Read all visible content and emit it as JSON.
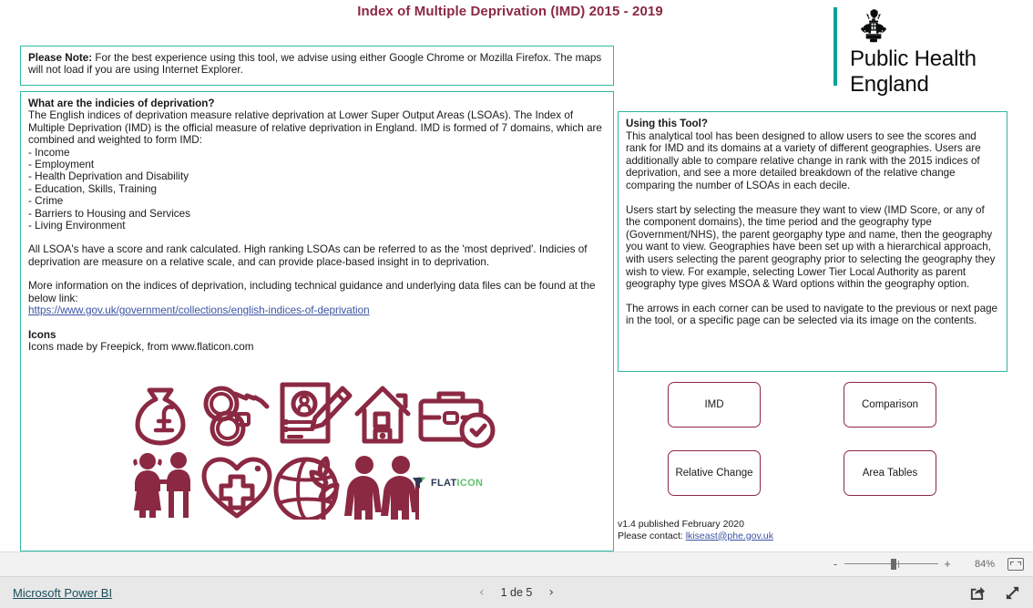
{
  "report": {
    "title": "Index of Multiple Deprivation (IMD) 2015 - 2019"
  },
  "logo": {
    "line1": "Public Health",
    "line2": "England",
    "crest_name": "royal-crest-icon",
    "rule_color": "#00A39B"
  },
  "note": {
    "label": "Please Note:",
    "text": " For the best experience using this tool, we advise using either Google Chrome or Mozilla Firefox. The maps will not load if you are using Internet Explorer."
  },
  "indices": {
    "heading": "What are the indicies of deprivation?",
    "intro": "The English indices of deprivation measure relative deprivation at Lower Super Output Areas (LSOAs). The Index of Multiple Deprivation (IMD) is the official measure of relative deprivation in England. IMD is formed of 7 domains, which are combined and weighted to form IMD:",
    "domains": [
      "- Income",
      "- Employment",
      "- Health Deprivation and Disability",
      "- Education, Skills, Training",
      "- Crime",
      "- Barriers to Housing and Services",
      "- Living Environment"
    ],
    "para2": "All LSOA's have a score and rank calculated. High ranking LSOAs can be referred to as the 'most deprived'. Indicies of deprivation are measure on a relative scale, and can provide place-based insight in to deprivation.",
    "para3": "More information on the indices of deprivation, including technical guidance and underlying data files can be found at the below link:",
    "link": "https://www.gov.uk/government/collections/english-indices-of-deprivation",
    "icons_heading": "Icons",
    "icons_credit": "Icons made by Freepick, from www.flaticon.com",
    "icon_art": {
      "color": "#8B2942",
      "items": [
        "money-bag-pound-icon",
        "handcuffs-icon",
        "document-person-pencil-icon",
        "house-icon",
        "briefcase-clock-icon",
        "children-holding-hands-icon",
        "heart-medical-cross-icon",
        "globe-plant-icon",
        "elderly-couple-icon"
      ],
      "watermark": {
        "part1": "FLAT",
        "part2": "ICON"
      }
    }
  },
  "tool": {
    "heading": "Using this Tool?",
    "para1": "This analytical tool has been designed to allow users to see the scores and rank for IMD and its domains at a variety of different geographies. Users are additionally able to compare relative change in rank  with the 2015 indices of deprivation, and see a more detailed breakdown of the relative change comparing the number of LSOAs in each decile.",
    "para2": "Users start by selecting the measure they want to view (IMD Score, or any of the component domains), the time period and the geography type (Government/NHS), the parent georgaphy type and name, then the geography you want to view. Geographies have been set up with a hierarchical approach, with users selecting the parent geography prior to selecting the geography they wish to view. For example, selecting Lower Tier Local Authority as parent geography type gives MSOA & Ward options within the geography option.",
    "para3": "The arrows in each corner can be used to navigate to the previous or next page in the tool, or a specific page can be selected via its image on the contents."
  },
  "nav_buttons": {
    "border_color": "#8B2942",
    "imd": "IMD",
    "comparison": "Comparison",
    "relative_change": "Relative Change",
    "area_tables": "Area Tables"
  },
  "credit": {
    "version": "v1.4 published February 2020",
    "contact_label": "Please contact: ",
    "contact_email": "lkiseast@phe.gov.uk"
  },
  "zoombar": {
    "minus": "-",
    "plus": "+",
    "zoom_level": "84%",
    "fit_icon": "fit-to-page-icon"
  },
  "statusbar": {
    "powerbi_label": "Microsoft Power BI",
    "prev_icon": "chevron-left-icon",
    "next_icon": "chevron-right-icon",
    "page_label": "1 de 5",
    "share_icon": "share-icon",
    "fullscreen_icon": "fullscreen-icon"
  }
}
